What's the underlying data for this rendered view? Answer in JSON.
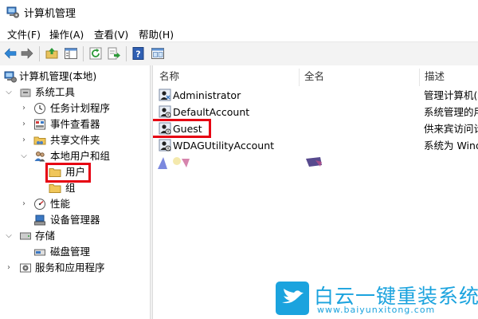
{
  "window": {
    "title": "计算机管理"
  },
  "menu": [
    {
      "label": "文件(F)"
    },
    {
      "label": "操作(A)"
    },
    {
      "label": "查看(V)"
    },
    {
      "label": "帮助(H)"
    }
  ],
  "tree": {
    "root": "计算机管理(本地)",
    "system_tools": "系统工具",
    "task_scheduler": "任务计划程序",
    "event_viewer": "事件查看器",
    "shared_folders": "共享文件夹",
    "local_users_groups": "本地用户和组",
    "users": "用户",
    "groups": "组",
    "performance": "性能",
    "device_manager": "设备管理器",
    "storage": "存储",
    "disk_management": "磁盘管理",
    "services_apps": "服务和应用程序"
  },
  "list": {
    "columns": [
      "名称",
      "全名",
      "描述"
    ],
    "rows": [
      {
        "name": "Administrator",
        "fullname": "",
        "desc": "管理计算机(域"
      },
      {
        "name": "DefaultAccount",
        "fullname": "",
        "desc": "系统管理的用"
      },
      {
        "name": "Guest",
        "fullname": "",
        "desc": "供来宾访问计"
      },
      {
        "name": "WDAGUtilityAccount",
        "fullname": "",
        "desc": "系统为 Windo"
      }
    ]
  },
  "watermark": {
    "brand": "白云一键重装系统",
    "url": "www.baiyunxitong.com"
  },
  "colors": {
    "highlight_box": "#e60012",
    "watermark": "#1ba3de",
    "toolbar_bg": "#f3f3f3"
  }
}
